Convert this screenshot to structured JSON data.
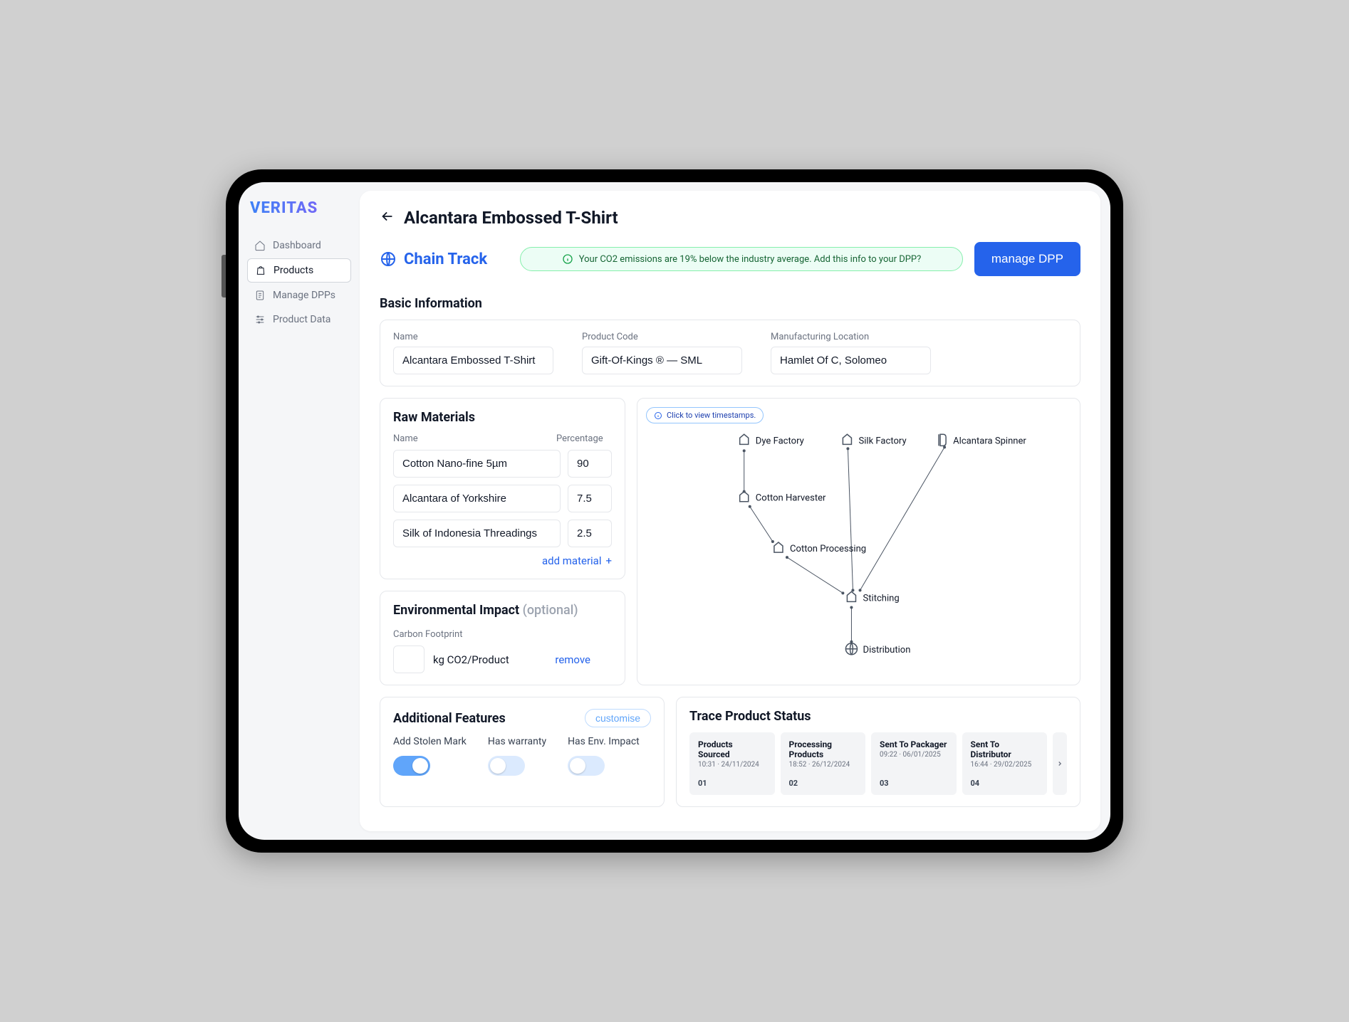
{
  "logo": "VERITAS",
  "sidebar": {
    "items": [
      {
        "label": "Dashboard",
        "icon": "home"
      },
      {
        "label": "Products",
        "icon": "bag"
      },
      {
        "label": "Manage DPPs",
        "icon": "doc"
      },
      {
        "label": "Product Data",
        "icon": "sliders"
      }
    ]
  },
  "page": {
    "title": "Alcantara Embossed T-Shirt",
    "section_label": "Chain Track",
    "banner": "Your CO2 emissions are 19% below the industry average. Add this info to your DPP?",
    "manage_btn": "manage DPP"
  },
  "basic": {
    "heading": "Basic Information",
    "name_label": "Name",
    "name": "Alcantara Embossed T-Shirt",
    "code_label": "Product Code",
    "code": "Gift-Of-Kings ® — SML",
    "loc_label": "Manufacturing Location",
    "loc": "Hamlet Of C, Solomeo"
  },
  "materials": {
    "heading": "Raw Materials",
    "name_col": "Name",
    "pct_col": "Percentage",
    "rows": [
      {
        "name": "Cotton Nano-fine 5µm",
        "pct": "90"
      },
      {
        "name": "Alcantara of Yorkshire",
        "pct": "7.5"
      },
      {
        "name": "Silk of Indonesia Threadings",
        "pct": "2.5"
      }
    ],
    "add": "add material"
  },
  "env": {
    "heading": "Environmental Impact",
    "optional": "(optional)",
    "cf_label": "Carbon Footprint",
    "unit": "kg  CO2/Product",
    "remove": "remove"
  },
  "diagram": {
    "hint": "Click to view timestamps.",
    "nodes": {
      "dye": "Dye Factory",
      "silk": "Silk Factory",
      "alc": "Alcantara Spinner",
      "harv": "Cotton Harvester",
      "proc": "Cotton Processing",
      "stitch": "Stitching",
      "dist": "Distribution"
    }
  },
  "features": {
    "heading": "Additional Features",
    "customise": "customise",
    "toggles": [
      {
        "label": "Add Stolen Mark",
        "on": true
      },
      {
        "label": "Has warranty",
        "on": false
      },
      {
        "label": "Has Env. Impact",
        "on": false
      }
    ]
  },
  "trace": {
    "heading": "Trace Product Status",
    "cards": [
      {
        "title": "Products Sourced",
        "time": "10:31 · 24/11/2024",
        "num": "01"
      },
      {
        "title": "Processing Products",
        "time": "18:52 · 26/12/2024",
        "num": "02"
      },
      {
        "title": "Sent To Packager",
        "time": "09:22 · 06/01/2025",
        "num": "03"
      },
      {
        "title": "Sent To Distributor",
        "time": "16:44 · 29/02/2025",
        "num": "04"
      }
    ]
  }
}
